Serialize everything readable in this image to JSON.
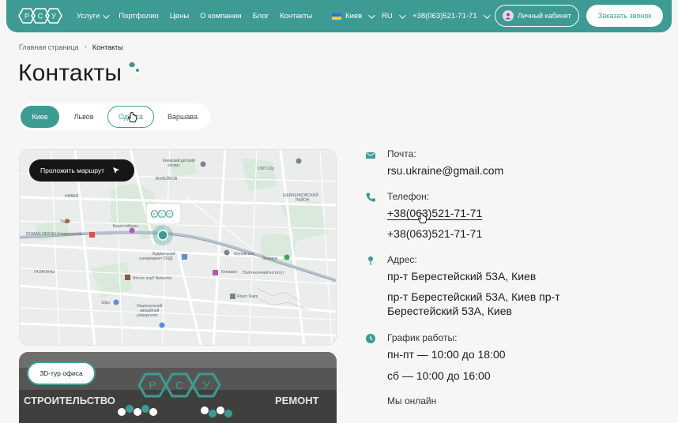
{
  "header": {
    "logo_letters": [
      "Р",
      "С",
      "У"
    ],
    "nav": [
      {
        "label": "Услуги",
        "dropdown": true
      },
      {
        "label": "Портфолио",
        "dropdown": false
      },
      {
        "label": "Цены",
        "dropdown": false
      },
      {
        "label": "О компании",
        "dropdown": false
      },
      {
        "label": "Блог",
        "dropdown": false
      },
      {
        "label": "Контакты",
        "dropdown": false
      }
    ],
    "city": "Киев",
    "lang": "RU",
    "phone": "+38(063)521-71-71",
    "cabinet": "Личный кабинет",
    "callback": "Заказать звонок"
  },
  "breadcrumb": {
    "home": "Главная страница",
    "current": "Контакты"
  },
  "page_title": "Контакты",
  "city_tabs": [
    "Киев",
    "Львов",
    "Одесса",
    "Варшава"
  ],
  "map": {
    "route_button": "Проложить маршрут",
    "labels": {
      "l1": "Киевский детский",
      "l2": "хоспис",
      "l3": "ВОЛЕЙКОВ",
      "l4": "UNIT.City",
      "l5": "НИВКИ",
      "l6": "ШЕВЧЕНКОВСКИЙ",
      "l7": "РАЙОН",
      "l8": "Тарас",
      "l9": "ROMAN ORTHO Стоматологія",
      "l10": "Берестейська",
      "l11": "Будівельний",
      "l12": "супермаркет ОЛДІ",
      "l13": "Шулявська",
      "l14": "Зоопарк",
      "l15": "Кіномані",
      "l16": "Політехнічний інститут",
      "l17": "ГАЛАГАНЫ",
      "l18": "Фітнес клуб Networks",
      "l19": "Risen Team",
      "l20": "Silpo",
      "l21": "Національний",
      "l22": "авіаційний",
      "l23": "університет"
    },
    "marker_letters": [
      "Р",
      "С",
      "У"
    ]
  },
  "photo": {
    "tour_button": "3D-тур офиса",
    "sign_left": "СТРОИТЕЛЬСТВО",
    "sign_right": "РЕМОНТ",
    "sign_letters": [
      "Р",
      "С",
      "У"
    ]
  },
  "contacts": {
    "mail_label": "Почта:",
    "mail_value": "rsu.ukraine@gmail.com",
    "phone_label": "Телефон:",
    "phone_1": "+38(063)521-71-71",
    "phone_2": "+38(063)521-71-71",
    "address_label": "Адрес:",
    "address_1": "пр-т Берестейский 53А, Киев",
    "address_2_line1": "пр-т Берестейский 53А, Киев пр-т",
    "address_2_line2": "Берестейский 53А, Киев",
    "hours_label": "График работы:",
    "hours_1": "пн-пт — 10:00 до 18:00",
    "hours_2": "сб — 10:00 до 16:00",
    "online_label": "Мы онлайн"
  },
  "colors": {
    "accent": "#3d9b93",
    "dark": "#161616",
    "background": "#f6f6f4"
  }
}
